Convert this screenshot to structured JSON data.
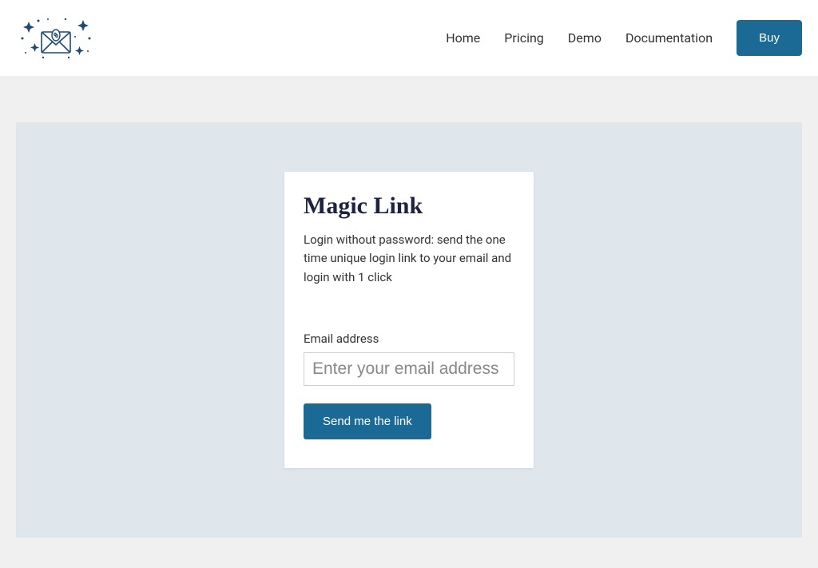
{
  "nav": {
    "links": [
      "Home",
      "Pricing",
      "Demo",
      "Documentation"
    ],
    "buy": "Buy"
  },
  "card": {
    "title": "Magic Link",
    "description": "Login without password: send the one time unique login link to your email and login with 1 click",
    "email_label": "Email address",
    "email_placeholder": "Enter your email address",
    "submit_label": "Send me the link"
  },
  "colors": {
    "primary": "#1a6a95",
    "title": "#1d2240"
  }
}
